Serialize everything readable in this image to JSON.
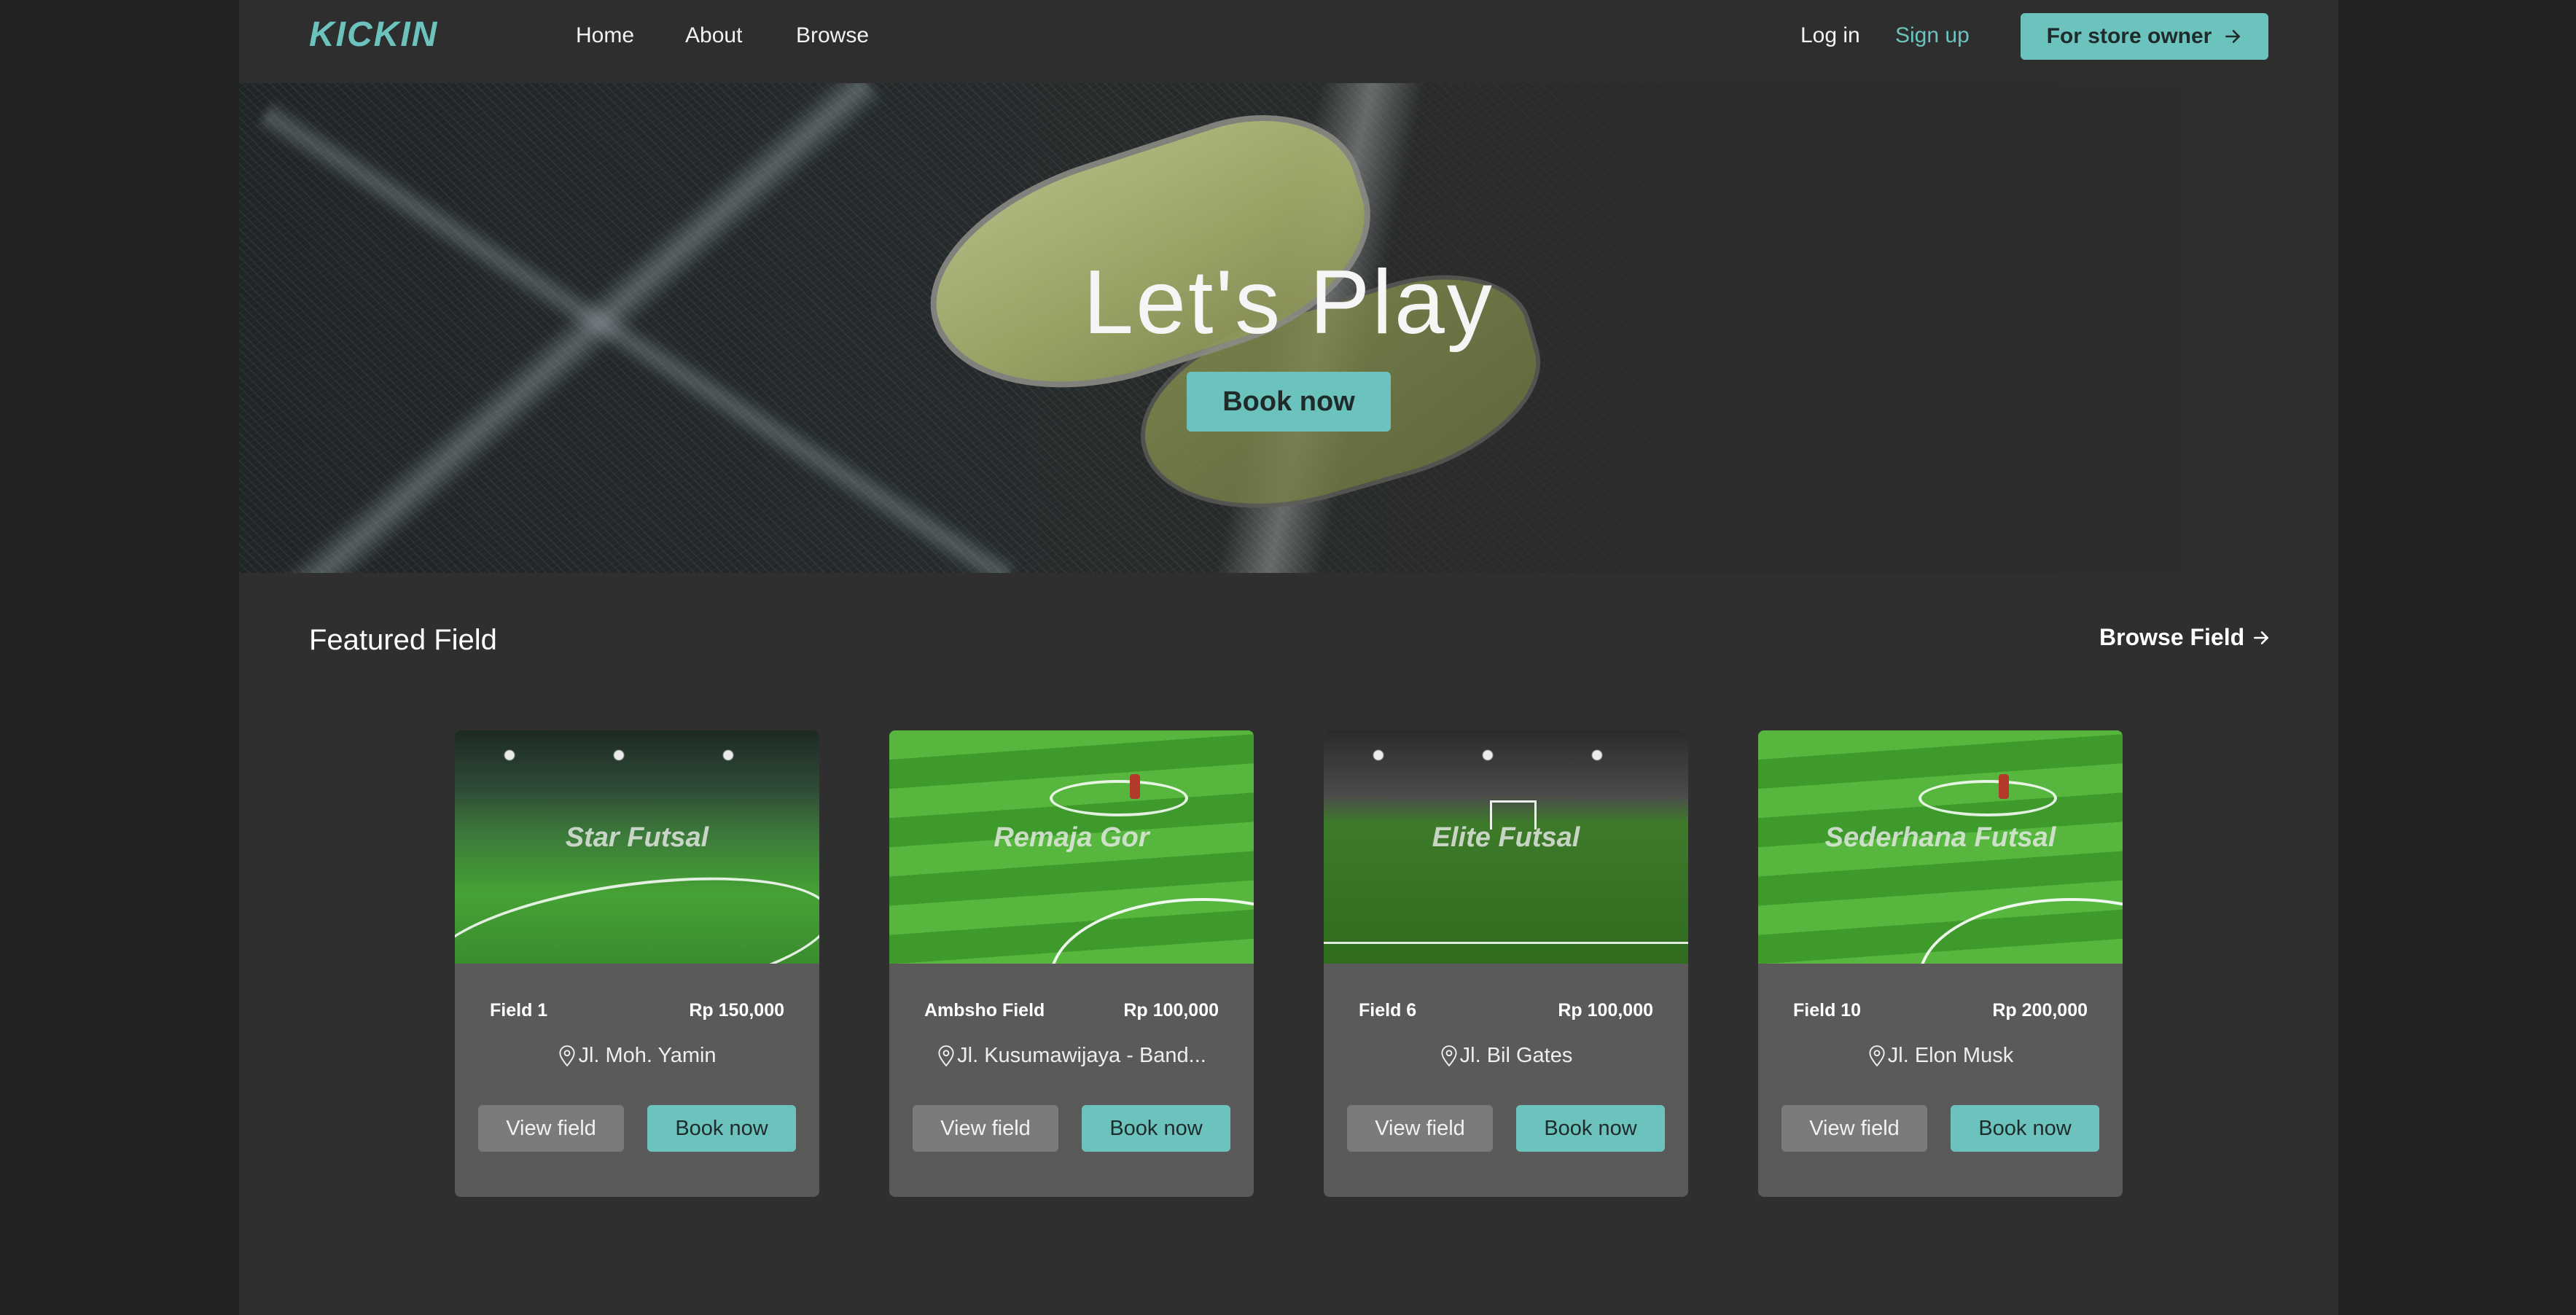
{
  "nav": {
    "logo": "KICKIN",
    "links": [
      "Home",
      "About",
      "Browse"
    ],
    "login": "Log in",
    "signup": "Sign up",
    "store_owner": "For store owner"
  },
  "hero": {
    "title": "Let's Play",
    "cta": "Book now"
  },
  "featured": {
    "title": "Featured Field",
    "browse": "Browse Field",
    "cards": [
      {
        "overlay": "Star Futsal",
        "name": "Field 1",
        "price": "Rp 150,000",
        "address": "Jl. Moh. Yamin",
        "view": "View field",
        "book": "Book now"
      },
      {
        "overlay": "Remaja Gor",
        "name": "Ambsho Field",
        "price": "Rp 100,000",
        "address": "Jl. Kusumawijaya - Band...",
        "view": "View field",
        "book": "Book now"
      },
      {
        "overlay": "Elite Futsal",
        "name": "Field 6",
        "price": "Rp 100,000",
        "address": "Jl. Bil Gates",
        "view": "View field",
        "book": "Book now"
      },
      {
        "overlay": "Sederhana Futsal",
        "name": "Field 10",
        "price": "Rp 200,000",
        "address": "Jl. Elon Musk",
        "view": "View field",
        "book": "Book now"
      }
    ]
  },
  "colors": {
    "accent": "#6cc3bd",
    "page_bg": "#2f2f2f",
    "card_bg": "#5a5a5a"
  },
  "icons": {
    "store_arrow": "arrow-right-icon",
    "browse_arrow": "arrow-right-icon",
    "address": "map-pin-icon"
  }
}
